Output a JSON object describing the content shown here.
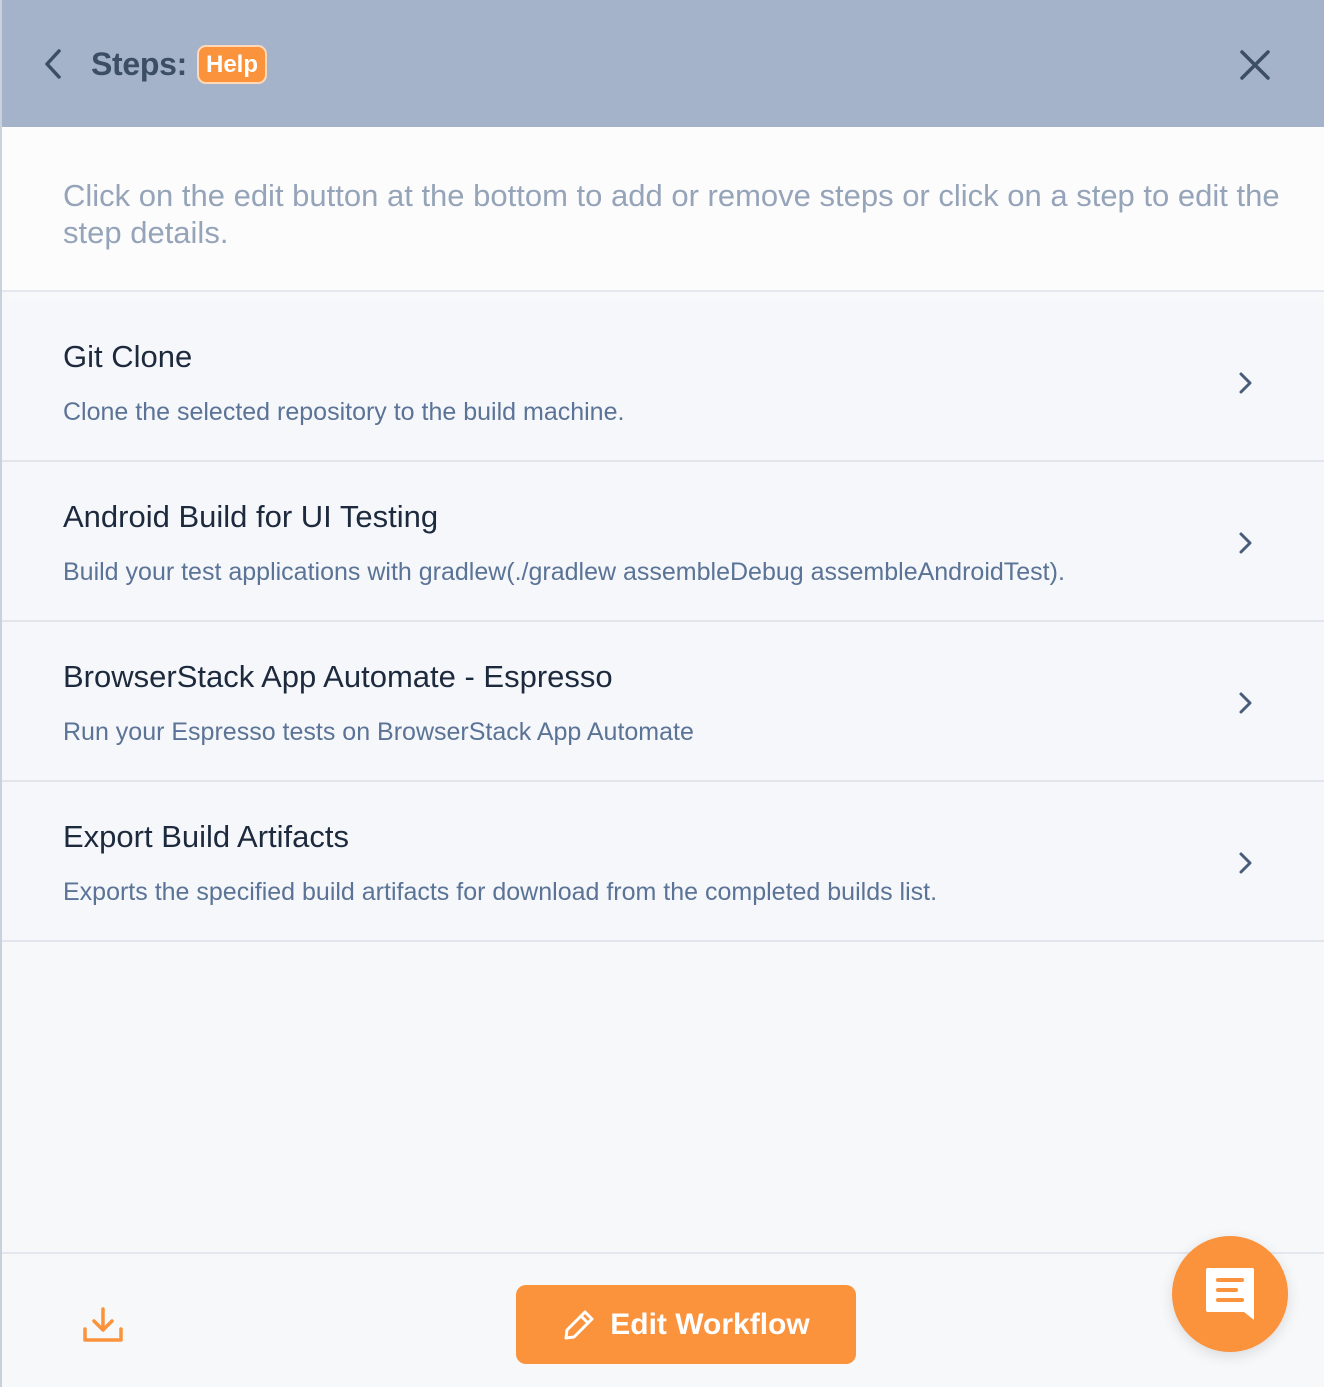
{
  "header": {
    "title": "Steps:",
    "help_label": "Help",
    "back_icon": "chevron-left-icon",
    "close_icon": "close-icon"
  },
  "intro": {
    "text": "Click on the edit button at the bottom to add or remove steps or click on a step to edit the step details."
  },
  "steps": [
    {
      "title": "Git Clone",
      "description": "Clone the selected repository to the build machine."
    },
    {
      "title": "Android Build for UI Testing",
      "description": "Build your test applications with gradlew(./gradlew assembleDebug assembleAndroidTest)."
    },
    {
      "title": "BrowserStack App Automate - Espresso",
      "description": "Run your Espresso tests on BrowserStack App Automate"
    },
    {
      "title": "Export Build Artifacts",
      "description": "Exports the specified build artifacts for download from the completed builds list."
    }
  ],
  "footer": {
    "edit_label": "Edit Workflow",
    "download_icon": "download-icon",
    "edit_icon": "pencil-icon"
  },
  "chat": {
    "icon": "chat-icon"
  },
  "colors": {
    "accent": "#fb923c",
    "header_bg": "#a4b3c9",
    "title_text": "#3c4d66",
    "step_title": "#1d2a3d",
    "step_desc": "#5a7396",
    "intro_text": "#95a4b8"
  }
}
